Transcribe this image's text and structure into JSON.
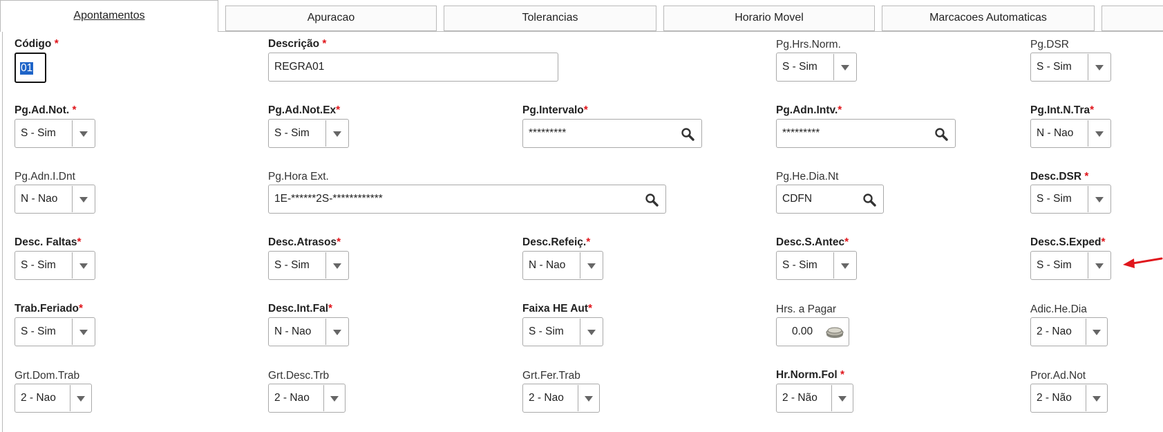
{
  "tabs": [
    {
      "label": "Apontamentos"
    },
    {
      "label": "Apuracao"
    },
    {
      "label": "Tolerancias"
    },
    {
      "label": "Horario Movel"
    },
    {
      "label": "Marcacoes Automaticas"
    }
  ],
  "required_mark": "*",
  "fields": {
    "codigo": {
      "label": "Código",
      "value": "01"
    },
    "descricao": {
      "label": "Descrição",
      "value": "REGRA01"
    },
    "pg_hrs_norm": {
      "label": "Pg.Hrs.Norm.",
      "value": "S - Sim"
    },
    "pg_dsr": {
      "label": "Pg.DSR",
      "value": "S - Sim"
    },
    "pg_ad_not": {
      "label": "Pg.Ad.Not.",
      "value": "S - Sim"
    },
    "pg_ad_not_ex": {
      "label": "Pg.Ad.Not.Ex",
      "value": "S - Sim"
    },
    "pg_intervalo": {
      "label": "Pg.Intervalo",
      "value": "*********"
    },
    "pg_adn_intv": {
      "label": "Pg.Adn.Intv.",
      "value": "*********"
    },
    "pg_int_n_tra": {
      "label": "Pg.Int.N.Tra",
      "value": "N - Nao"
    },
    "pg_adn_i_dnt": {
      "label": "Pg.Adn.I.Dnt",
      "value": "N - Nao"
    },
    "pg_hora_ext": {
      "label": "Pg.Hora Ext.",
      "value": "1E-******2S-************"
    },
    "pg_he_dia_nt": {
      "label": "Pg.He.Dia.Nt",
      "value": "CDFN"
    },
    "desc_dsr": {
      "label": "Desc.DSR",
      "value": "S - Sim"
    },
    "desc_faltas": {
      "label": "Desc. Faltas",
      "value": "S - Sim"
    },
    "desc_atrasos": {
      "label": "Desc.Atrasos",
      "value": "S - Sim"
    },
    "desc_refeic": {
      "label": "Desc.Refeiç.",
      "value": "N - Nao"
    },
    "desc_s_antec": {
      "label": "Desc.S.Antec",
      "value": "S - Sim"
    },
    "desc_s_exped": {
      "label": "Desc.S.Exped",
      "value": "S - Sim"
    },
    "trab_feriado": {
      "label": "Trab.Feriado",
      "value": "S - Sim"
    },
    "desc_int_fal": {
      "label": "Desc.Int.Fal",
      "value": "N - Nao"
    },
    "faixa_he_aut": {
      "label": "Faixa HE Aut",
      "value": "S - Sim"
    },
    "hrs_a_pagar": {
      "label": "Hrs. a Pagar",
      "value": "0.00"
    },
    "adic_he_dia": {
      "label": "Adic.He.Dia",
      "value": "2 - Nao"
    },
    "grt_dom_trab": {
      "label": "Grt.Dom.Trab",
      "value": "2 - Nao"
    },
    "grt_desc_trb": {
      "label": "Grt.Desc.Trb",
      "value": "2 - Nao"
    },
    "grt_fer_trab": {
      "label": "Grt.Fer.Trab",
      "value": "2 - Nao"
    },
    "hr_norm_fol": {
      "label": "Hr.Norm.Fol",
      "value": "2 - Não"
    },
    "pror_ad_not": {
      "label": "Pror.Ad.Not",
      "value": "2 - Não"
    }
  },
  "colors": {
    "required": "#e0161c",
    "selection": "#1e64c8",
    "annotation_arrow": "#e0161c"
  }
}
